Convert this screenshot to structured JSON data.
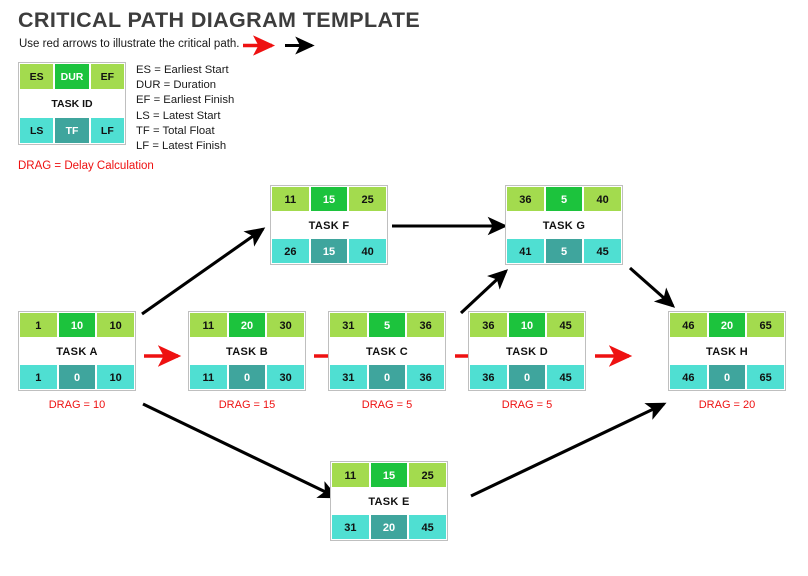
{
  "header": {
    "title": "CRITICAL PATH DIAGRAM TEMPLATE",
    "instruction": "Use red arrows to illustrate the critical path.",
    "red_arrow_icon": "red-arrow-right",
    "black_arrow_icon": "black-arrow-right"
  },
  "legend": {
    "key_box": {
      "top_row": [
        "ES",
        "DUR",
        "EF"
      ],
      "middle_row": "TASK ID",
      "bottom_row": [
        "LS",
        "TF",
        "LF"
      ]
    },
    "definitions": [
      "ES = Earliest Start",
      "DUR = Duration",
      "EF = Earliest Finish",
      "LS = Latest Start",
      "TF = Total Float",
      "LF = Latest Finish"
    ],
    "drag_note": "DRAG = Delay Calculation"
  },
  "colors": {
    "light_green": "#a3db4e",
    "green": "#1cc33d",
    "turquoise": "#4fdfd2",
    "teal": "#3fa59d",
    "white": "#ffffff",
    "red": "#ee1111",
    "black": "#000000",
    "title_gray": "#3d3d3d",
    "border_gray": "#bfbfbf"
  },
  "chart_data": {
    "type": "diagram",
    "title": "CRITICAL PATH DIAGRAM TEMPLATE",
    "nodes": [
      {
        "id": "A",
        "label": "TASK A",
        "es": "1",
        "dur": "10",
        "ef": "10",
        "ls": "1",
        "tf": "0",
        "lf": "10",
        "drag": "DRAG = 10"
      },
      {
        "id": "B",
        "label": "TASK B",
        "es": "11",
        "dur": "20",
        "ef": "30",
        "ls": "11",
        "tf": "0",
        "lf": "30",
        "drag": "DRAG = 15"
      },
      {
        "id": "C",
        "label": "TASK C",
        "es": "31",
        "dur": "5",
        "ef": "36",
        "ls": "31",
        "tf": "0",
        "lf": "36",
        "drag": "DRAG = 5"
      },
      {
        "id": "D",
        "label": "TASK D",
        "es": "36",
        "dur": "10",
        "ef": "45",
        "ls": "36",
        "tf": "0",
        "lf": "45",
        "drag": "DRAG = 5"
      },
      {
        "id": "H",
        "label": "TASK H",
        "es": "46",
        "dur": "20",
        "ef": "65",
        "ls": "46",
        "tf": "0",
        "lf": "65",
        "drag": "DRAG = 20"
      },
      {
        "id": "F",
        "label": "TASK F",
        "es": "11",
        "dur": "15",
        "ef": "25",
        "ls": "26",
        "tf": "15",
        "lf": "40",
        "drag": ""
      },
      {
        "id": "G",
        "label": "TASK G",
        "es": "36",
        "dur": "5",
        "ef": "40",
        "ls": "41",
        "tf": "5",
        "lf": "45",
        "drag": ""
      },
      {
        "id": "E",
        "label": "TASK E",
        "es": "11",
        "dur": "15",
        "ef": "25",
        "ls": "31",
        "tf": "20",
        "lf": "45",
        "drag": ""
      }
    ],
    "edges": [
      {
        "from": "A",
        "to": "B",
        "color": "red",
        "style": "horizontal"
      },
      {
        "from": "B",
        "to": "C",
        "color": "red",
        "style": "horizontal"
      },
      {
        "from": "C",
        "to": "D",
        "color": "red",
        "style": "horizontal"
      },
      {
        "from": "D",
        "to": "H",
        "color": "red",
        "style": "horizontal"
      },
      {
        "from": "A",
        "to": "F",
        "color": "black",
        "style": "diagonal-up"
      },
      {
        "from": "F",
        "to": "G",
        "color": "black",
        "style": "horizontal"
      },
      {
        "from": "C",
        "to": "G",
        "color": "black",
        "style": "diagonal-up"
      },
      {
        "from": "G",
        "to": "H",
        "color": "black",
        "style": "diagonal-down"
      },
      {
        "from": "A",
        "to": "E",
        "color": "black",
        "style": "diagonal-down"
      },
      {
        "from": "E",
        "to": "H",
        "color": "black",
        "style": "diagonal-up"
      }
    ]
  }
}
